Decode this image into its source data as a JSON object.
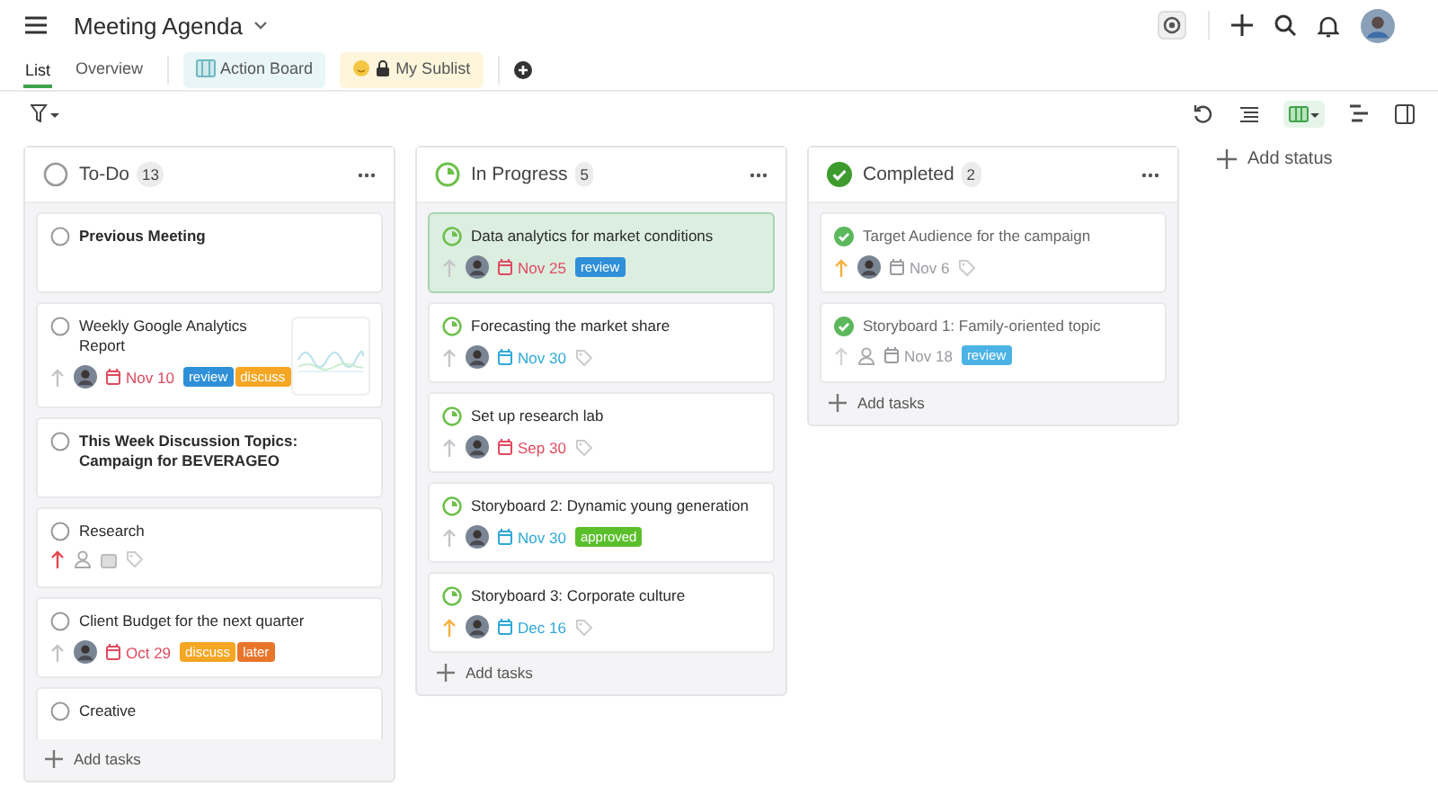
{
  "header": {
    "title": "Meeting Agenda"
  },
  "tabs": [
    {
      "label": "List",
      "selected": true,
      "kind": "plain"
    },
    {
      "label": "Overview",
      "selected": false,
      "kind": "plain"
    },
    {
      "label": "Action Board",
      "selected": false,
      "kind": "board",
      "color": "#e8f6f7"
    },
    {
      "label": "My Sublist",
      "selected": false,
      "kind": "sublist",
      "color": "#fdf6dc"
    }
  ],
  "toolbar": {
    "board_view_selected": true
  },
  "columns": [
    {
      "name": "To-Do",
      "count": "13",
      "kind": "todo",
      "add_label": "Add tasks",
      "cards": [
        {
          "title": "Previous Meeting",
          "bold": true,
          "selected": false,
          "meta": false
        },
        {
          "title": "Weekly Google Analytics Report",
          "bold": false,
          "selected": false,
          "meta": true,
          "priority": {
            "color": "#c4c4c8"
          },
          "assignee": true,
          "date": {
            "text": "Nov 10",
            "color": "#e04a5f"
          },
          "thumbnail": true,
          "tags": [
            {
              "label": "review",
              "color": "#2f8fd8"
            },
            {
              "label": "discuss",
              "color": "#f5a623"
            }
          ]
        },
        {
          "title": "This Week Discussion Topics: Campaign for BEVERAGEO",
          "bold": true,
          "selected": false,
          "meta": false
        },
        {
          "title": "Research",
          "bold": false,
          "selected": false,
          "meta": true,
          "priority": {
            "color": "#e5484d"
          },
          "assignee": false
        },
        {
          "title": "Client Budget for the next quarter",
          "bold": false,
          "selected": false,
          "meta": true,
          "priority": {
            "color": "#c4c4c8"
          },
          "assignee": true,
          "date": {
            "text": "Oct 29",
            "color": "#e04a5f"
          },
          "tags": [
            {
              "label": "discuss",
              "color": "#f5a623"
            },
            {
              "label": "later",
              "color": "#e8752a"
            }
          ]
        },
        {
          "title": "Creative",
          "bold": false,
          "selected": false,
          "meta": false
        }
      ]
    },
    {
      "name": "In Progress",
      "count": "5",
      "kind": "progress",
      "add_label": "Add tasks",
      "cards": [
        {
          "title": "Data analytics for market conditions",
          "bold": false,
          "selected": true,
          "meta": true,
          "priority": {
            "color": "#c4c4c8"
          },
          "assignee": true,
          "date": {
            "text": "Nov 25",
            "color": "#e04a5f"
          },
          "tags": [
            {
              "label": "review",
              "color": "#2f8fd8"
            }
          ]
        },
        {
          "title": "Forecasting the market share",
          "bold": false,
          "selected": false,
          "meta": true,
          "priority": {
            "color": "#c4c4c8"
          },
          "assignee": true,
          "date": {
            "text": "Nov 30",
            "color": "#2ea8d8"
          }
        },
        {
          "title": "Set up research lab",
          "bold": false,
          "selected": false,
          "meta": true,
          "priority": {
            "color": "#c4c4c8"
          },
          "assignee": true,
          "date": {
            "text": "Sep 30",
            "color": "#e04a5f"
          }
        },
        {
          "title": "Storyboard 2: Dynamic young generation",
          "bold": false,
          "selected": false,
          "meta": true,
          "priority": {
            "color": "#c4c4c8"
          },
          "assignee": true,
          "date": {
            "text": "Nov 30",
            "color": "#2ea8d8"
          },
          "tags": [
            {
              "label": "approved",
              "color": "#5bbf2c"
            }
          ]
        },
        {
          "title": "Storyboard 3: Corporate culture",
          "bold": false,
          "selected": false,
          "meta": true,
          "priority": {
            "color": "#f5b03c"
          },
          "assignee": true,
          "date": {
            "text": "Dec 16",
            "color": "#2ea8d8"
          }
        }
      ]
    },
    {
      "name": "Completed",
      "count": "2",
      "kind": "done",
      "add_label": "Add tasks",
      "cards": [
        {
          "title": "Target Audience for the campaign",
          "bold": false,
          "selected": false,
          "meta": true,
          "priority": {
            "color": "#f5b03c"
          },
          "assignee": true,
          "date": {
            "text": "Nov 6",
            "color": "#9a9aa0"
          }
        },
        {
          "title": "Storyboard 1: Family-oriented topic",
          "bold": false,
          "selected": false,
          "meta": true,
          "priority": {
            "color": "#d4d4d8"
          },
          "assignee": false,
          "date": {
            "text": "Nov 18",
            "color": "#9a9aa0"
          },
          "tags": [
            {
              "label": "review",
              "color": "#4bb3e6"
            }
          ]
        }
      ]
    }
  ],
  "add_status": "Add status"
}
